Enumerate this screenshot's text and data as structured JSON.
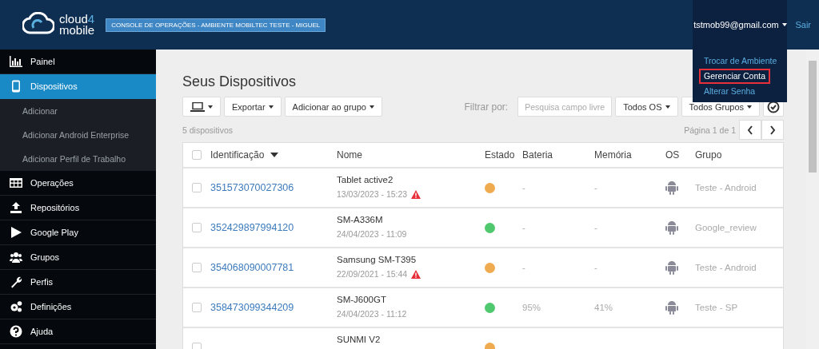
{
  "header": {
    "logo_text_1": "cloud",
    "logo_digit": "4",
    "logo_text_2": "mobile",
    "environment_badge": "CONSOLE DE OPERAÇÕES - AMBIENTE MOBILTEC TESTE - MIGUEL",
    "user_email": "tstmob99@gmail.com",
    "logout": "Sair"
  },
  "user_menu": {
    "expanded": true,
    "items": [
      {
        "label": "Trocar de Ambiente",
        "highlighted": false
      },
      {
        "label": "Gerenciar Conta",
        "highlighted": true
      },
      {
        "label": "Alterar Senha",
        "highlighted": false
      }
    ]
  },
  "sidebar": {
    "items": [
      {
        "label": "Painel",
        "kind": "chart",
        "selected": false
      },
      {
        "label": "Dispositivos",
        "kind": "phone",
        "selected": true,
        "children": [
          {
            "label": "Adicionar"
          },
          {
            "label": "Adicionar Android Enterprise"
          },
          {
            "label": "Adicionar Perfil de Trabalho"
          }
        ]
      },
      {
        "label": "Operações",
        "kind": "table",
        "selected": false
      },
      {
        "label": "Repositórios",
        "kind": "upload",
        "selected": false
      },
      {
        "label": "Google Play",
        "kind": "play",
        "selected": false
      },
      {
        "label": "Grupos",
        "kind": "users",
        "selected": false
      },
      {
        "label": "Perfis",
        "kind": "wrench",
        "selected": false
      },
      {
        "label": "Definições",
        "kind": "gears",
        "selected": false
      },
      {
        "label": "Ajuda",
        "kind": "help",
        "selected": false
      }
    ]
  },
  "page": {
    "title": "Seus Dispositivos",
    "toolbar": {
      "export": "Exportar",
      "add_to_group": "Adicionar ao grupo",
      "filter_label": "Filtrar por:",
      "search_placeholder": "Pesquisa campo livre",
      "os_filter": "Todos OS",
      "group_filter": "Todos Grupos"
    },
    "count": "5 dispositivos",
    "pagination": "Página 1 de 1"
  },
  "table": {
    "all_checked": false,
    "columns": [
      "Identificação",
      "Nome",
      "Estado",
      "Bateria",
      "Memória",
      "OS",
      "Grupo"
    ],
    "rows": [
      {
        "checked": false,
        "id": "351573070027306",
        "name": "Tablet active2",
        "date": "13/03/2023 - 15:23",
        "warning": true,
        "color": "#efab4f",
        "battery": "-",
        "memory": "-",
        "group": "Teste - Android"
      },
      {
        "checked": false,
        "id": "352429897994120",
        "name": "SM-A336M",
        "date": "24/04/2023 - 11:09",
        "warning": false,
        "color": "#4fc86e",
        "battery": "-",
        "memory": "-",
        "group": "Google_review"
      },
      {
        "checked": false,
        "id": "354068090007781",
        "name": "Samsung SM-T395",
        "date": "22/09/2021 - 15:44",
        "warning": true,
        "color": "#efab4f",
        "battery": "-",
        "memory": "-",
        "group": "Teste - Android"
      },
      {
        "checked": false,
        "id": "358473099344209",
        "name": "SM-J600GT",
        "date": "24/04/2023 - 11:12",
        "warning": false,
        "color": "#4fc86e",
        "battery": "95%",
        "memory": "41%",
        "group": "Teste - SP"
      },
      {
        "checked": false,
        "name": "SUNMI V2",
        "warning": false,
        "color": "#efab4f"
      }
    ]
  }
}
